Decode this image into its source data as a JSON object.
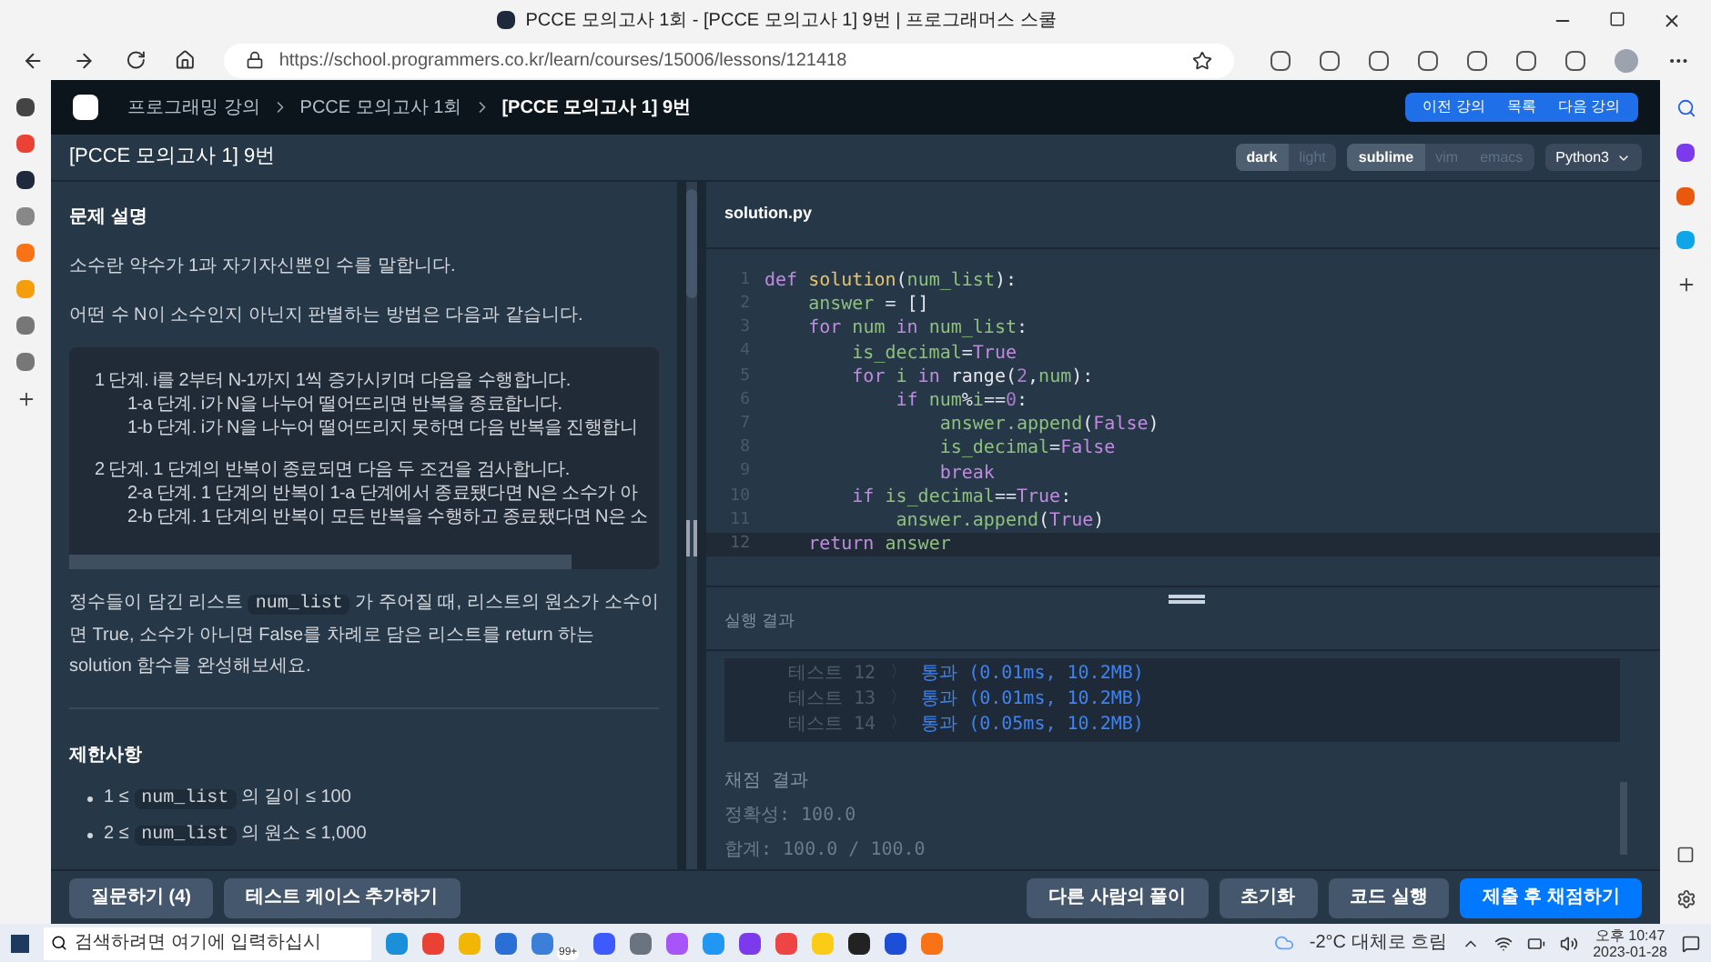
{
  "browser": {
    "title": "PCCE 모의고사 1회 - [PCCE 모의고사 1] 9번 | 프로그래머스 스쿨",
    "url": "https://school.programmers.co.kr/learn/courses/15006/lessons/121418"
  },
  "nav": {
    "breadcrumbs": [
      "프로그래밍 강의",
      "PCCE 모의고사 1회",
      "[PCCE 모의고사 1] 9번"
    ],
    "buttons": [
      "이전 강의",
      "목록",
      "다음 강의"
    ]
  },
  "header": {
    "title": "[PCCE 모의고사 1] 9번",
    "themes": [
      {
        "label": "dark",
        "selected": true
      },
      {
        "label": "light",
        "selected": false
      }
    ],
    "keymaps": [
      {
        "label": "sublime",
        "selected": true
      },
      {
        "label": "vim",
        "selected": false
      },
      {
        "label": "emacs",
        "selected": false
      }
    ],
    "language": "Python3"
  },
  "description": {
    "heading": "문제 설명",
    "paragraphs": [
      "소수란 약수가 1과 자기자신뿐인 수를 말합니다.",
      "어떤 수 N이 소수인지 아닌지 판별하는 방법은 다음과 같습니다."
    ],
    "steps": [
      {
        "text": "1 단계. i를 2부터 N-1까지 1씩 증가시키며 다음을 수행합니다.",
        "children": [
          {
            "text": "1-a 단계. i가 N을 나누어 떨어뜨리면 반복을 종료합니다."
          },
          {
            "text": "1-b 단계. i가 N을 나누어 떨어뜨리지 못하면 다음 반복을 진행합니"
          }
        ]
      },
      {
        "text": "2 단계. 1 단계의 반복이 종료되면 다음 두 조건을 검사합니다.",
        "children": [
          {
            "text": "2-a 단계. 1 단계의 반복이 1-a 단계에서 종료됐다면 N은 소수가 아"
          },
          {
            "text": "2-b 단계. 1 단계의 반복이 모든 반복을 수행하고 종료됐다면 N은 소"
          }
        ]
      }
    ],
    "task": [
      {
        "text": "정수들이 담긴 리스트 ",
        "code": false
      },
      {
        "text": "num_list",
        "code": true
      },
      {
        "text": " 가 주어질 때, 리스트의 원소가 소수이면 True, 소수가 아니면 False를 차례로 담은 리스트를 return 하는 solution 함수를 완성해보세요.",
        "code": false
      }
    ],
    "limits_heading": "제한사항",
    "limits": [
      [
        {
          "text": "1 ≤ ",
          "code": false
        },
        {
          "text": "num_list",
          "code": true
        },
        {
          "text": " 의 길이 ≤ 100",
          "code": false
        }
      ],
      [
        {
          "text": "2 ≤ ",
          "code": false
        },
        {
          "text": "num_list",
          "code": true
        },
        {
          "text": " 의 원소 ≤ 1,000",
          "code": false
        }
      ]
    ]
  },
  "editor": {
    "filename": "solution.py",
    "lines": [
      {
        "number": "1",
        "active": false,
        "tokens": [
          {
            "kind": "kw",
            "text": "def "
          },
          {
            "kind": "fn",
            "text": "solution"
          },
          {
            "kind": "plain",
            "text": "("
          },
          {
            "kind": "var",
            "text": "num_list"
          },
          {
            "kind": "plain",
            "text": "):"
          }
        ]
      },
      {
        "number": "2",
        "active": false,
        "tokens": [
          {
            "kind": "var",
            "text": "    answer"
          },
          {
            "kind": "plain",
            "text": " = []"
          }
        ]
      },
      {
        "number": "3",
        "active": false,
        "tokens": [
          {
            "kind": "kw",
            "text": "    for "
          },
          {
            "kind": "var",
            "text": "num "
          },
          {
            "kind": "kw",
            "text": "in "
          },
          {
            "kind": "var",
            "text": "num_list"
          },
          {
            "kind": "plain",
            "text": ":"
          }
        ]
      },
      {
        "number": "4",
        "active": false,
        "tokens": [
          {
            "kind": "var",
            "text": "        is_decimal"
          },
          {
            "kind": "plain",
            "text": "="
          },
          {
            "kind": "kw",
            "text": "True"
          }
        ]
      },
      {
        "number": "5",
        "active": false,
        "tokens": [
          {
            "kind": "kw",
            "text": "        for "
          },
          {
            "kind": "var",
            "text": "i "
          },
          {
            "kind": "kw",
            "text": "in "
          },
          {
            "kind": "plain",
            "text": "range("
          },
          {
            "kind": "num",
            "text": "2"
          },
          {
            "kind": "plain",
            "text": ","
          },
          {
            "kind": "var",
            "text": "num"
          },
          {
            "kind": "plain",
            "text": "):"
          }
        ]
      },
      {
        "number": "6",
        "active": false,
        "tokens": [
          {
            "kind": "kw",
            "text": "            if "
          },
          {
            "kind": "var",
            "text": "num"
          },
          {
            "kind": "plain",
            "text": "%"
          },
          {
            "kind": "var",
            "text": "i"
          },
          {
            "kind": "plain",
            "text": "=="
          },
          {
            "kind": "num",
            "text": "0"
          },
          {
            "kind": "plain",
            "text": ":"
          }
        ]
      },
      {
        "number": "7",
        "active": false,
        "tokens": [
          {
            "kind": "var",
            "text": "                answer.append"
          },
          {
            "kind": "plain",
            "text": "("
          },
          {
            "kind": "kw",
            "text": "False"
          },
          {
            "kind": "plain",
            "text": ")"
          }
        ]
      },
      {
        "number": "8",
        "active": false,
        "tokens": [
          {
            "kind": "var",
            "text": "                is_decimal"
          },
          {
            "kind": "plain",
            "text": "="
          },
          {
            "kind": "kw",
            "text": "False"
          }
        ]
      },
      {
        "number": "9",
        "active": false,
        "tokens": [
          {
            "kind": "kw",
            "text": "                break"
          }
        ]
      },
      {
        "number": "10",
        "active": false,
        "tokens": [
          {
            "kind": "kw",
            "text": "        if "
          },
          {
            "kind": "var",
            "text": "is_decimal"
          },
          {
            "kind": "plain",
            "text": "=="
          },
          {
            "kind": "kw",
            "text": "True"
          },
          {
            "kind": "plain",
            "text": ":"
          }
        ]
      },
      {
        "number": "11",
        "active": false,
        "tokens": [
          {
            "kind": "var",
            "text": "            answer.append"
          },
          {
            "kind": "plain",
            "text": "("
          },
          {
            "kind": "kw",
            "text": "True"
          },
          {
            "kind": "plain",
            "text": ")"
          }
        ]
      },
      {
        "number": "12",
        "active": true,
        "tokens": [
          {
            "kind": "kw",
            "text": "    return "
          },
          {
            "kind": "var",
            "text": "answer"
          }
        ]
      }
    ]
  },
  "results": {
    "heading": "실행 결과",
    "tests": [
      {
        "label": "테스트 12",
        "separator": "〉",
        "result": "통과 (0.01ms, 10.2MB)"
      },
      {
        "label": "테스트 13",
        "separator": "〉",
        "result": "통과 (0.01ms, 10.2MB)"
      },
      {
        "label": "테스트 14",
        "separator": "〉",
        "result": "통과 (0.05ms, 10.2MB)"
      }
    ],
    "grading_heading": "채점 결과",
    "grading": [
      "정확성: 100.0",
      "합계: 100.0 / 100.0"
    ]
  },
  "footer": {
    "left_buttons": [
      "질문하기 (4)",
      "테스트 케이스 추가하기"
    ],
    "right_buttons": [
      {
        "label": "다른 사람의 풀이",
        "kind": "secondary"
      },
      {
        "label": "초기화",
        "kind": "secondary"
      },
      {
        "label": "코드 실행",
        "kind": "secondary"
      },
      {
        "label": "제출 후 채점하기",
        "kind": "primary"
      }
    ]
  },
  "taskbar": {
    "search": {
      "placeholder": "검색하려면 여기에 입력하십시"
    },
    "mail_badge": "99+",
    "weather": "-2°C 대체로 흐림",
    "time": "오후 10:47",
    "date": "2023-01-28"
  }
}
